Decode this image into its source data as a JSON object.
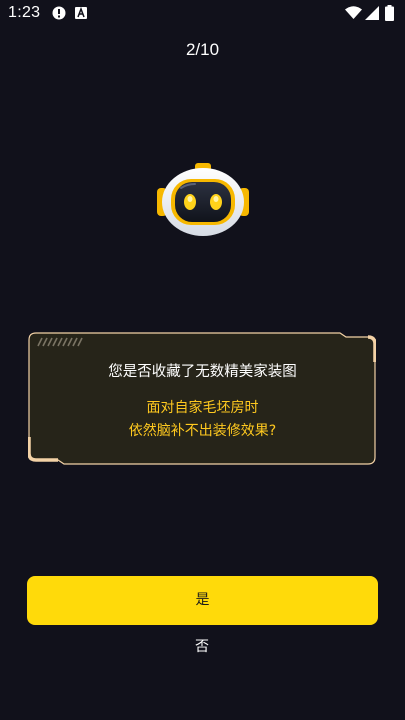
{
  "status_bar": {
    "time": "1:23",
    "icons": [
      "alert-icon",
      "a-icon",
      "wifi-icon",
      "signal-icon",
      "battery-icon"
    ]
  },
  "progress": {
    "label": "2/10"
  },
  "mascot": {
    "icon": "robot-mascot-icon"
  },
  "card": {
    "question": "您是否收藏了无数精美家装图",
    "sub_line_1": "面对自家毛坯房时",
    "sub_line_2": "依然脑补不出装修效果?"
  },
  "actions": {
    "yes_label": "是",
    "no_label": "否"
  },
  "colors": {
    "background": "#11111b",
    "accent_yellow": "#ffda0a",
    "highlight_text": "#ffc91f",
    "card_fill": "#262419",
    "card_border": "#f3d2a6"
  }
}
